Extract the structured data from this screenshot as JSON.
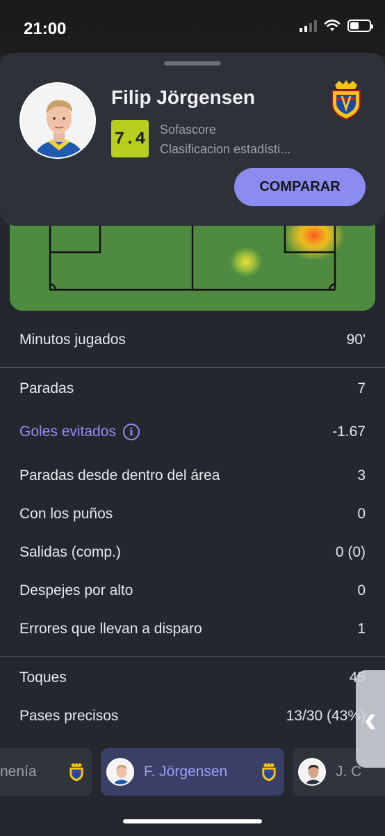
{
  "status_bar": {
    "time": "21:00"
  },
  "player_card": {
    "name": "Filip Jörgensen",
    "rating": "7.4",
    "source_line1": "Sofascore",
    "source_line2": "Clasificacion estadísti...",
    "compare_label": "COMPARAR",
    "accent_color": "#8c8cf0",
    "rating_color": "#b9cf1f"
  },
  "stats": {
    "group1": [
      {
        "label": "Minutos jugados",
        "value": "90'"
      }
    ],
    "group2": [
      {
        "label": "Paradas",
        "value": "7"
      },
      {
        "label": "Goles evitados",
        "value": "-1.67",
        "link": true,
        "icon": "info-icon"
      },
      {
        "label": "Paradas desde dentro del área",
        "value": "3"
      },
      {
        "label": "Con los puños",
        "value": "0"
      },
      {
        "label": "Salidas (comp.)",
        "value": "0 (0)"
      },
      {
        "label": "Despejes por alto",
        "value": "0"
      },
      {
        "label": "Errores que llevan a disparo",
        "value": "1"
      }
    ],
    "group3": [
      {
        "label": "Toques",
        "value": "45"
      },
      {
        "label": "Pases precisos",
        "value": "13/30 (43%)"
      }
    ]
  },
  "carousel": {
    "items": [
      {
        "label": "nenía"
      },
      {
        "label": "F. Jörgensen",
        "active": true
      },
      {
        "label": "J. C"
      }
    ]
  }
}
